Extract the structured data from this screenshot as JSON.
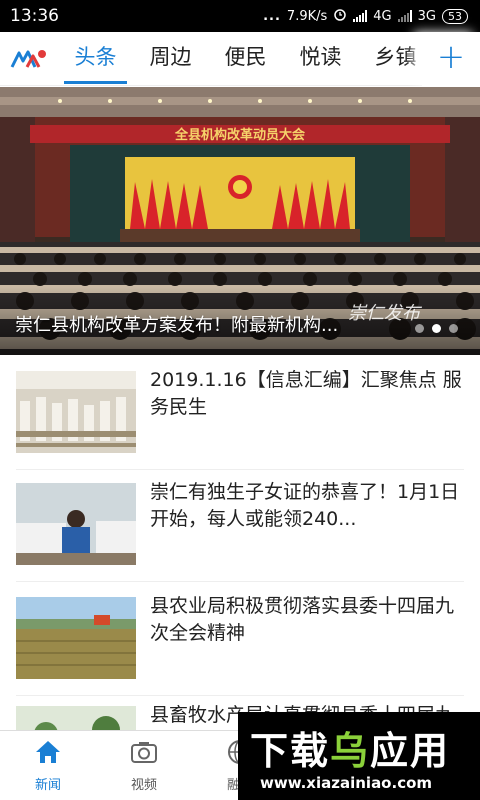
{
  "status_bar": {
    "time": "13:36",
    "dots": "...",
    "speed": "7.9K/s",
    "network_1": "4G",
    "network_2": "3G",
    "battery": "53"
  },
  "tabs": [
    {
      "label": "头条",
      "active": true
    },
    {
      "label": "周边",
      "active": false
    },
    {
      "label": "便民",
      "active": false
    },
    {
      "label": "悦读",
      "active": false
    },
    {
      "label": "乡镇",
      "active": false
    }
  ],
  "plus_label": "+",
  "banner": {
    "caption": "崇仁县机构改革方案发布！附最新机构...",
    "stage_banner_text": "全县机构改革动员大会",
    "signature": "崇仁发布",
    "dot_count": 3,
    "active_dot": 1
  },
  "news": [
    {
      "title": "2019.1.16【信息汇编】汇聚焦点 服务民生"
    },
    {
      "title": "崇仁有独生子女证的恭喜了！1月1日开始，每人或能领240..."
    },
    {
      "title": "县农业局积极贯彻落实县委十四届九次全会精神"
    },
    {
      "title": "县畜牧水产局认真贯彻县委十四届九次..."
    }
  ],
  "bottom_nav": [
    {
      "label": "新闻",
      "icon": "home-icon",
      "active": true
    },
    {
      "label": "视频",
      "icon": "camera-icon",
      "active": false
    },
    {
      "label": "融媒",
      "icon": "globe-icon",
      "active": false
    }
  ],
  "watermark": {
    "title_part1": "下载",
    "title_part2": "乌",
    "title_part3": "应用",
    "url": "www.xiazainiao.com"
  },
  "colors": {
    "accent": "#1a7fd4",
    "watermark_green": "#8bd13a"
  }
}
